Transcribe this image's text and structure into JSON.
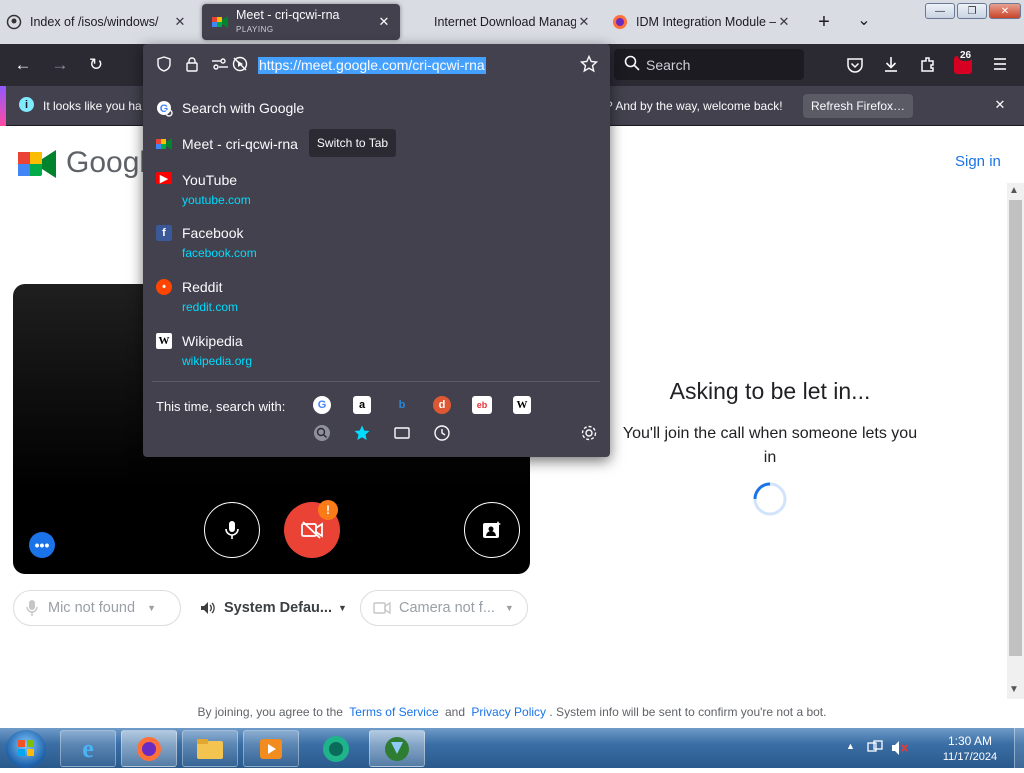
{
  "tabs": [
    {
      "title": "Index of /isos/windows/",
      "close": "✕"
    },
    {
      "title": "Meet - cri-qcwi-rna",
      "status": "PLAYING",
      "close": "✕"
    },
    {
      "title": "Internet Download Manager",
      "close": "✕"
    },
    {
      "title": "IDM Integration Module – C",
      "close": "✕"
    }
  ],
  "tabstrip": {
    "new_tab": "+",
    "list_all": "⌄"
  },
  "window_controls": {
    "minimize": "—",
    "maximize": "❐",
    "close": "✕"
  },
  "navbar": {
    "back": "←",
    "forward": "→",
    "reload": "↻",
    "url": "https://meet.google.com/cri-qcwi-rna",
    "search_placeholder": "Search",
    "badge_count": "26"
  },
  "notification": {
    "text_left": "It looks like you ha",
    "text_right": "? And by the way, welcome back!",
    "refresh_button": "Refresh Firefox…",
    "close": "✕"
  },
  "urlbar_dropdown": {
    "search_with": "Search with Google",
    "suggestions": [
      {
        "title": "Meet - cri-qcwi-rna",
        "url": ""
      },
      {
        "title": "YouTube",
        "url": "youtube.com"
      },
      {
        "title": "Facebook",
        "url": "facebook.com"
      },
      {
        "title": "Reddit",
        "url": "reddit.com"
      },
      {
        "title": "Wikipedia",
        "url": "wikipedia.org"
      }
    ],
    "switch_to_tab": "Switch to Tab",
    "this_time_search_with": "This time, search with:"
  },
  "meet": {
    "logo_text": "Googl",
    "sign_in": "Sign in",
    "status_title": "Asking to be let in...",
    "status_body": "You'll join the call when someone lets you in",
    "mic_pill": "Mic not found",
    "speaker_pill": "System Defau...",
    "camera_pill": "Camera not f...",
    "footer_prefix": "By joining, you agree to the",
    "terms": "Terms of Service",
    "and": "and",
    "privacy": "Privacy Policy",
    "footer_suffix": ". System info will be sent to confirm you're not a bot.",
    "warning_badge": "!"
  },
  "taskbar": {
    "time": "1:30 AM",
    "date": "11/17/2024",
    "tray_arrow": "▲"
  },
  "colors": {
    "firefox_dark": "#2b2a33",
    "panel": "#42414d",
    "accent_link": "#00ddff",
    "meet_red": "#ea4335",
    "meet_blue": "#1a73e8"
  }
}
